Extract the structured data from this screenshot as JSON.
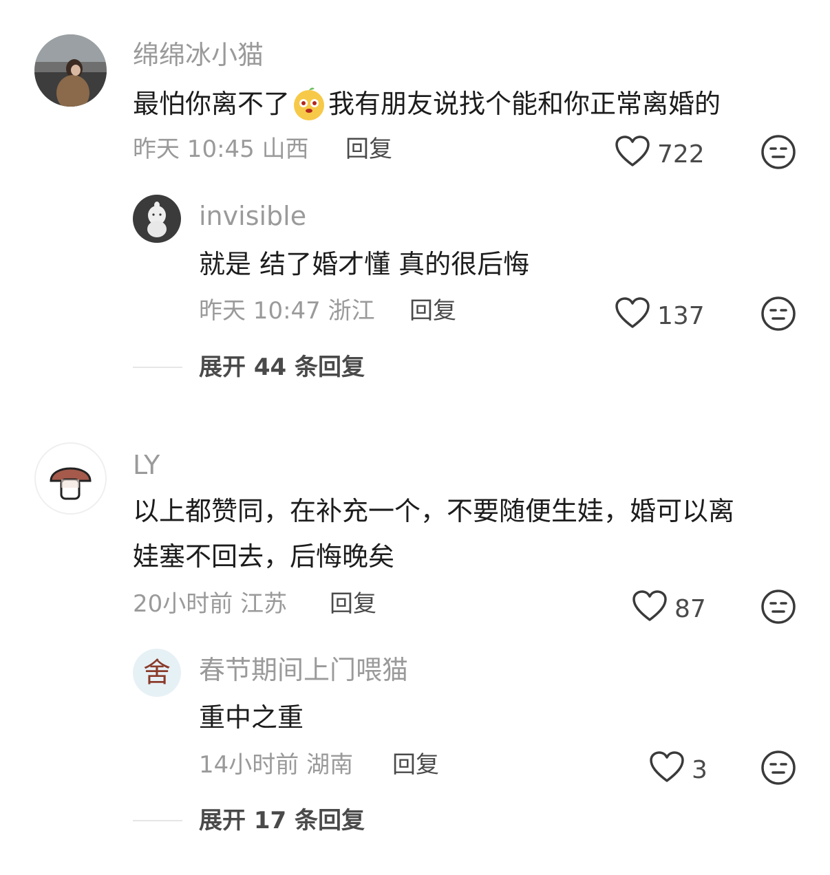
{
  "comments": [
    {
      "username": "绵绵冰小猫",
      "text_before_emoji": "最怕你离不了",
      "emoji": "doge-face-emoji",
      "text_after_emoji": "我有朋友说找个能和你正常离婚的",
      "time": "昨天 10:45",
      "location": "山西",
      "reply_label": "回复",
      "likes": "722",
      "replies": [
        {
          "username": "invisible",
          "text": "就是 结了婚才懂 真的很后悔",
          "time": "昨天 10:47",
          "location": "浙江",
          "reply_label": "回复",
          "likes": "137"
        }
      ],
      "expand_label": "展开 44 条回复"
    },
    {
      "username": "LY",
      "text_lines": [
        "以上都赞同，在补充一个，不要随便生娃，婚可以离",
        "娃塞不回去，后悔晚矣"
      ],
      "time": "20小时前",
      "location": "江苏",
      "reply_label": "回复",
      "likes": "87",
      "replies": [
        {
          "username": "春节期间上门喂猫",
          "text": "重中之重",
          "time": "14小时前",
          "location": "湖南",
          "reply_label": "回复",
          "likes": "3",
          "avatar_char": "舍"
        }
      ],
      "expand_label": "展开 17 条回复"
    }
  ],
  "icons": {
    "like": "heart-outline-icon",
    "dislike": "neutral-face-icon"
  },
  "colors": {
    "text_primary": "#1c1c1c",
    "text_secondary": "#9a9a9a",
    "action": "#4a4a4a",
    "divider": "#e6e6e6"
  }
}
